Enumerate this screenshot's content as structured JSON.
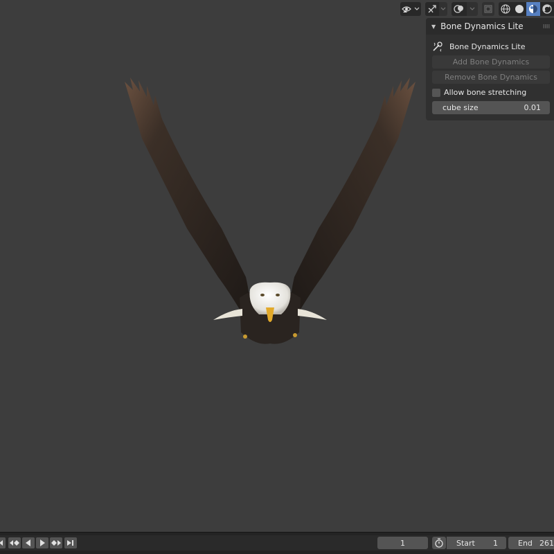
{
  "panel": {
    "title": "Bone Dynamics Lite",
    "tool_icon": "bone-dynamics-icon",
    "tool_label": "Bone Dynamics Lite",
    "add_button": "Add Bone Dynamics",
    "remove_button": "Remove Bone Dynamics",
    "stretch_label": "Allow bone stretching",
    "stretch_checked": false,
    "cube_size_label": "cube size",
    "cube_size_value": "0.01"
  },
  "header": {
    "icons": [
      "visibility-icon",
      "gizmo-icon",
      "overlay-icon",
      "xray-icon",
      "wireframe-shading-icon",
      "solid-shading-icon",
      "material-shading-icon",
      "rendered-shading-icon"
    ],
    "active_shading": "material-shading-icon"
  },
  "timeline": {
    "current_frame": "1",
    "start_label": "Start",
    "start_value": "1",
    "end_label": "End",
    "end_value": "261"
  },
  "colors": {
    "viewport_bg": "#3d3d3d",
    "accent": "#5680c2",
    "panel_bg": "#303030"
  }
}
